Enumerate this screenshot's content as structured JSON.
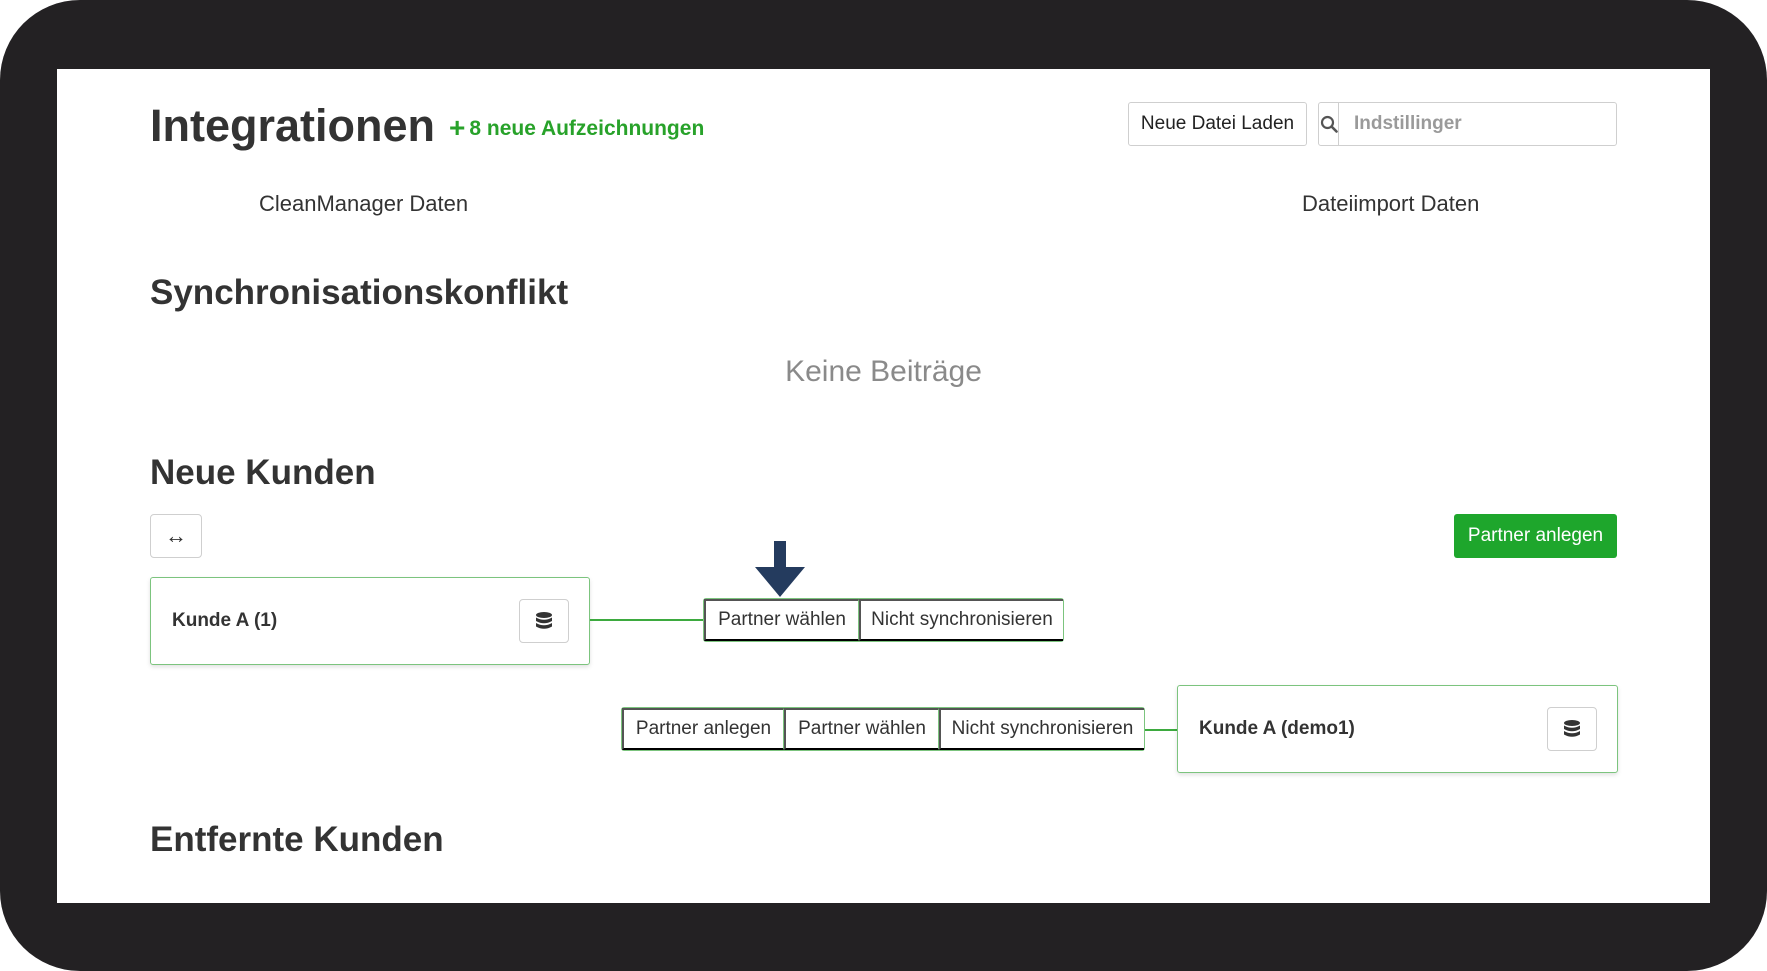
{
  "header": {
    "title": "Integrationen",
    "new_records_icon": "+",
    "new_records": "8 neue Aufzeichnungen",
    "load_button": "Neue Datei Laden",
    "search_placeholder": "Indstillinger"
  },
  "columns": {
    "left": "CleanManager Daten",
    "right": "Dateiimport Daten"
  },
  "sections": {
    "conflict": {
      "title": "Synchronisationskonflikt",
      "empty": "Keine Beiträge"
    },
    "new_customers": {
      "title": "Neue Kunden",
      "expand_icon": "↔",
      "create_partner_button": "Partner anlegen",
      "left_card": {
        "name": "Kunde A (1)",
        "actions": [
          "Partner wählen",
          "Nicht synchronisieren"
        ]
      },
      "right_card": {
        "name": "Kunde A (demo1)",
        "actions": [
          "Partner anlegen",
          "Partner wählen",
          "Nicht synchronisieren"
        ]
      }
    },
    "removed_customers": {
      "title": "Entfernte Kunden"
    }
  },
  "icons": {
    "search": "search-icon",
    "database": "database-icon",
    "arrow": "arrow-down-icon",
    "expand": "horizontal-arrows-icon"
  },
  "colors": {
    "accent_green": "#1ea62c",
    "text_green": "#28a22a",
    "border_green": "#7cc47e",
    "arrow_navy": "#243b5e",
    "frame": "#232123"
  }
}
